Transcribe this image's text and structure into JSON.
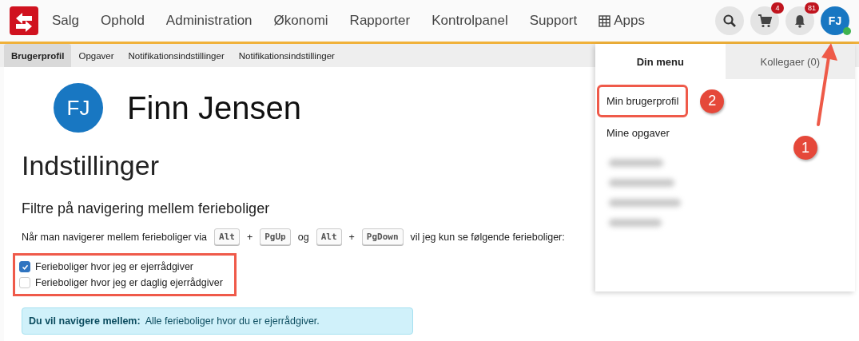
{
  "nav": {
    "items": [
      "Salg",
      "Ophold",
      "Administration",
      "Økonomi",
      "Rapporter",
      "Kontrolpanel",
      "Support"
    ],
    "apps": "Apps",
    "cart_count": "4",
    "bell_count": "81",
    "avatar": "FJ",
    "avatar_callout": "1"
  },
  "subnav": [
    {
      "label": "Brugerprofil",
      "selected": true
    },
    {
      "label": "Opgaver",
      "selected": false
    },
    {
      "label": "Notifikationsindstillinger",
      "selected": false
    },
    {
      "label": "Notifikationsindstillinger",
      "selected": false
    }
  ],
  "profile": {
    "initials": "FJ",
    "name": "Finn Jensen"
  },
  "settings": {
    "title": "Indstillinger",
    "section": "Filtre på navigering mellem ferieboliger",
    "intro": [
      "Når man navigerer mellem ferieboliger via",
      {
        "key": "Alt"
      },
      "+",
      {
        "key": "PgUp"
      },
      "og",
      {
        "key": "Alt"
      },
      "+",
      {
        "key": "PgDown"
      },
      "vil jeg kun se følgende ferieboliger:"
    ],
    "highlighted": true,
    "options": [
      {
        "label": "Ferieboliger hvor jeg er ejerrådgiver",
        "checked": true
      },
      {
        "label": "Ferieboliger hvor jeg er daglig ejerrådgiver",
        "checked": false
      }
    ],
    "info": {
      "label": "Du vil navigere mellem:",
      "text": "Alle ferieboliger hvor du er ejerrådgiver."
    }
  },
  "menu": {
    "tabs": [
      {
        "label": "Din menu",
        "selected": true
      },
      {
        "label": "Kollegaer (0)",
        "selected": false
      }
    ],
    "items": [
      {
        "label": "Min brugerprofil",
        "callout": "2"
      },
      {
        "label": "Mine opgaver"
      }
    ]
  }
}
